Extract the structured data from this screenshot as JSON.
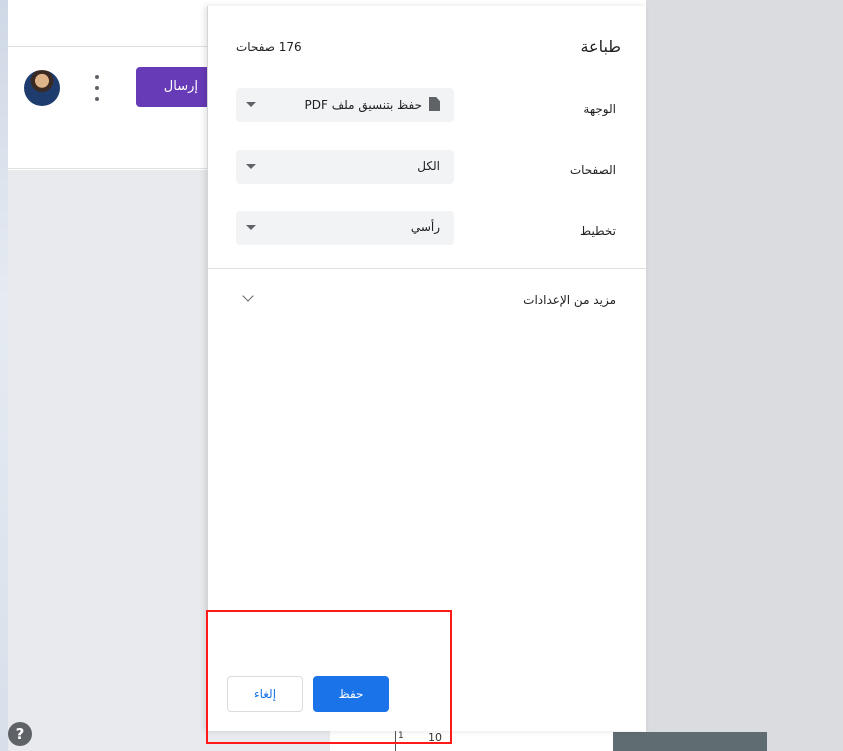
{
  "background": {
    "send_button_label": "إرسال",
    "help_icon": "?",
    "preview_page_number": "10",
    "preview_tick_label": "1"
  },
  "print_dialog": {
    "title": "طباعة",
    "page_count": "176 صفحات",
    "destination": {
      "label": "الوجهة",
      "value": "حفظ بتنسيق ملف PDF",
      "icon": "file-icon"
    },
    "pages": {
      "label": "الصفحات",
      "value": "الكل"
    },
    "layout": {
      "label": "تخطيط",
      "value": "رأسي"
    },
    "more_settings_label": "مزيد من الإعدادات",
    "save_button_label": "حفظ",
    "cancel_button_label": "إلغاء"
  },
  "colors": {
    "accent_blue": "#1a73e8",
    "send_purple": "#673ab7",
    "highlight_red": "#ff1a1a"
  }
}
